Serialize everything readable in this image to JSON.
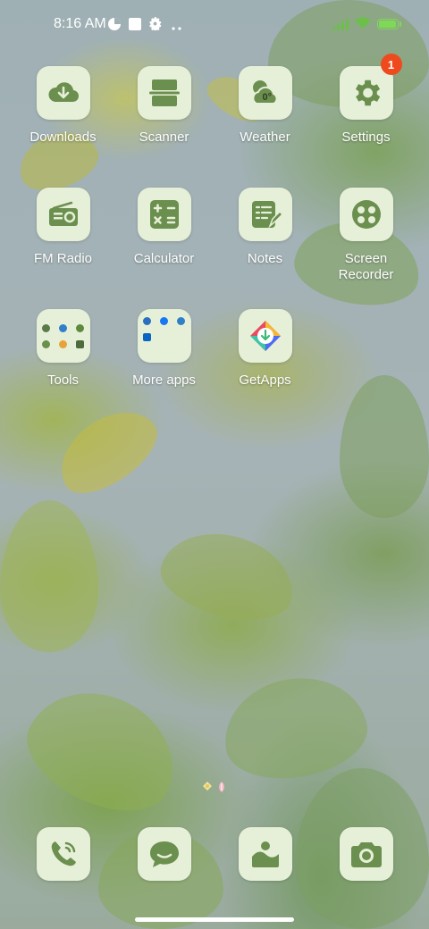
{
  "status_bar": {
    "time": "8:16 AM",
    "battery_level_percent": 100,
    "battery_text": "100"
  },
  "apps": [
    {
      "label": "Downloads",
      "icon": "download-cloud-icon"
    },
    {
      "label": "Scanner",
      "icon": "scanner-icon"
    },
    {
      "label": "Weather",
      "icon": "weather-icon",
      "temp": "0°"
    },
    {
      "label": "Settings",
      "icon": "gear-icon",
      "badge": "1"
    },
    {
      "label": "FM Radio",
      "icon": "radio-icon"
    },
    {
      "label": "Calculator",
      "icon": "calculator-icon"
    },
    {
      "label": "Notes",
      "icon": "notes-icon"
    },
    {
      "label": "Screen\nRecorder",
      "icon": "screen-recorder-icon"
    },
    {
      "label": "Tools",
      "icon": "folder-icon"
    },
    {
      "label": "More apps",
      "icon": "folder-icon"
    },
    {
      "label": "GetApps",
      "icon": "getapps-icon"
    }
  ],
  "dock": [
    {
      "name": "phone",
      "icon": "phone-icon"
    },
    {
      "name": "messages",
      "icon": "message-icon"
    },
    {
      "name": "gallery",
      "icon": "gallery-icon"
    },
    {
      "name": "camera",
      "icon": "camera-icon"
    }
  ],
  "colors": {
    "icon_bg": "#e6f0d8",
    "icon_fg": "#6b8f4e",
    "badge": "#ee4a1e"
  }
}
